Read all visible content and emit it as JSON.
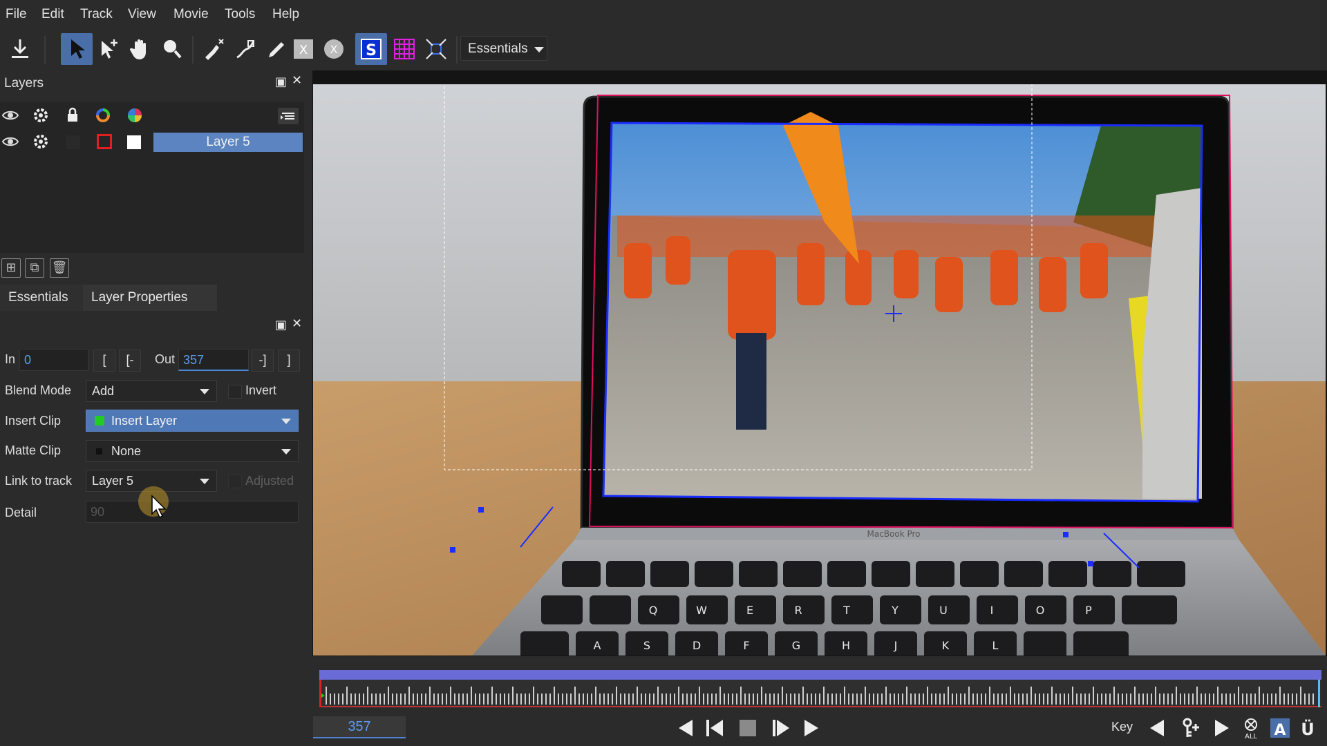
{
  "menu": [
    "File",
    "Edit",
    "Track",
    "View",
    "Movie",
    "Tools",
    "Help"
  ],
  "workspace": "Essentials",
  "layers_panel": {
    "title": "Layers",
    "layer_name": "Layer 5"
  },
  "tabs": {
    "essentials": "Essentials",
    "layer_properties": "Layer Properties"
  },
  "props": {
    "in_label": "In",
    "in_value": "0",
    "out_label": "Out",
    "out_value": "357",
    "bracket_in_a": "[",
    "bracket_in_b": "[-",
    "bracket_out_a": "-]",
    "bracket_out_b": "]",
    "blend_label": "Blend Mode",
    "blend_value": "Add",
    "invert_label": "Invert",
    "insert_label": "Insert Clip",
    "insert_value": "Insert Layer",
    "matte_label": "Matte Clip",
    "matte_value": "None",
    "link_label": "Link to track",
    "link_value": "Layer 5",
    "adjusted_label": "Adjusted",
    "detail_label": "Detail",
    "detail_value": "90"
  },
  "canvas": {
    "laptop_label": "MacBook Pro",
    "keys_row1": [
      "Q",
      "W",
      "E",
      "R",
      "T",
      "Y",
      "U",
      "I",
      "O",
      "P"
    ],
    "keys_row2": [
      "A",
      "S",
      "D",
      "F",
      "G",
      "H",
      "J",
      "K",
      "L"
    ]
  },
  "playback": {
    "frame": "357",
    "key_label": "Key"
  },
  "colors": {
    "accent": "#4a6fa8",
    "selection": "#5b84c0",
    "timeline_bar": "#6b6bd8",
    "tracker": "#1a2cff"
  }
}
